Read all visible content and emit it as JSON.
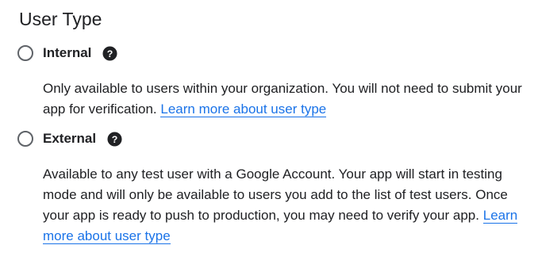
{
  "section": {
    "title": "User Type"
  },
  "options": [
    {
      "label": "Internal",
      "selected": false,
      "help_icon": "help-circle-icon",
      "description": "Only available to users within your organization. You will not need to submit your app for verification.",
      "link_text": "Learn more about user type"
    },
    {
      "label": "External",
      "selected": false,
      "help_icon": "help-circle-icon",
      "description": "Available to any test user with a Google Account. Your app will start in testing mode and will only be available to users you add to the list of test users. Once your app is ready to push to production, you may need to verify your app.",
      "link_text": "Learn more about user type"
    }
  ],
  "colors": {
    "text": "#202124",
    "link": "#1a73e8",
    "radio_border": "#5f6368"
  }
}
